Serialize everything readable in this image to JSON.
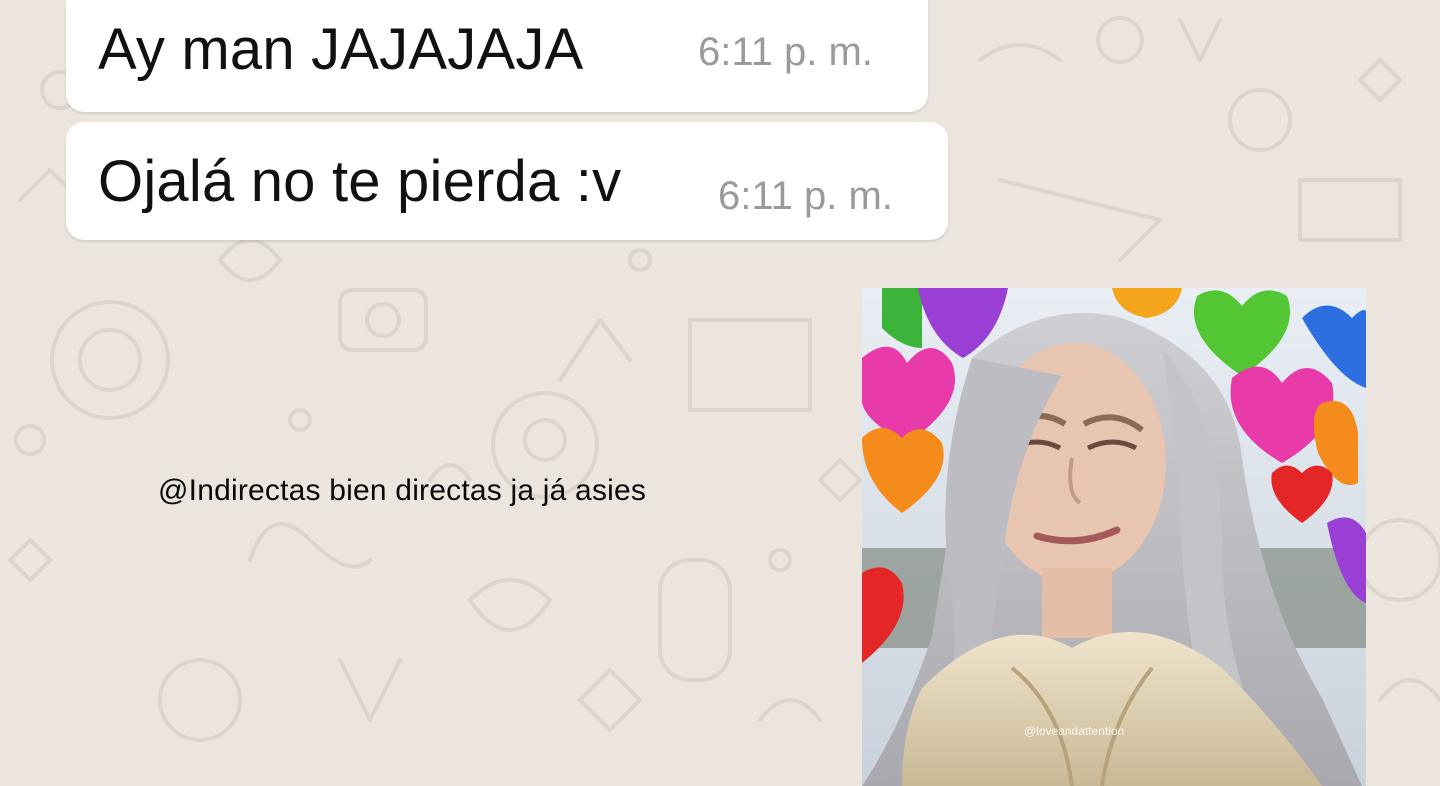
{
  "chat": {
    "messages": [
      {
        "text": "Ay man JAJAJAJA",
        "time": "6:11 p. m."
      },
      {
        "text": "Ojalá no te pierda :v",
        "time": "6:11 p. m."
      }
    ]
  },
  "caption": "@Indirectas bien directas ja já asies",
  "meme": {
    "watermark": "@loveandattention"
  },
  "colors": {
    "wallpaper": "#ebe5de",
    "bubble": "#ffffff",
    "timestamp": "#9a9a9a"
  }
}
